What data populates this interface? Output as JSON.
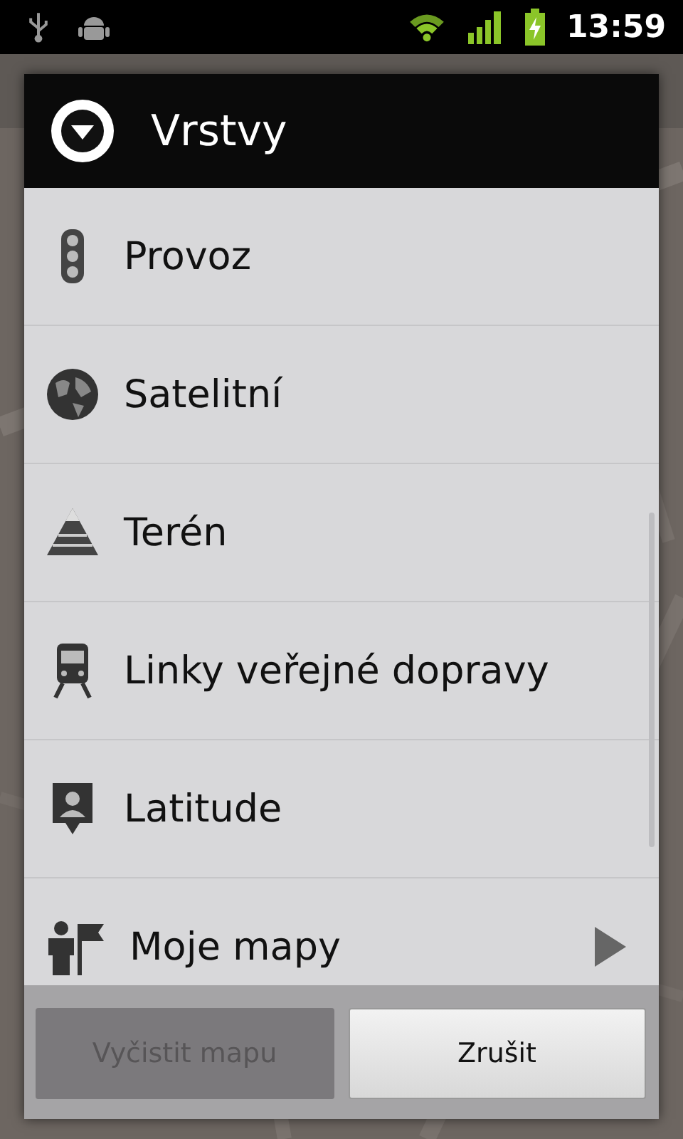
{
  "status_bar": {
    "time": "13:59"
  },
  "dialog": {
    "title": "Vrstvy",
    "items": [
      {
        "label": "Provoz",
        "kind": "traffic",
        "submenu": false
      },
      {
        "label": "Satelitní",
        "kind": "globe",
        "submenu": false
      },
      {
        "label": "Terén",
        "kind": "terrain",
        "submenu": false
      },
      {
        "label": "Linky veřejné dopravy",
        "kind": "transit",
        "submenu": false
      },
      {
        "label": "Latitude",
        "kind": "latitude",
        "submenu": false
      },
      {
        "label": "Moje mapy",
        "kind": "mymaps",
        "submenu": true
      }
    ],
    "buttons": [
      {
        "label": "Vyčistit mapu",
        "disabled": true
      },
      {
        "label": "Zrušit",
        "disabled": false
      }
    ]
  }
}
